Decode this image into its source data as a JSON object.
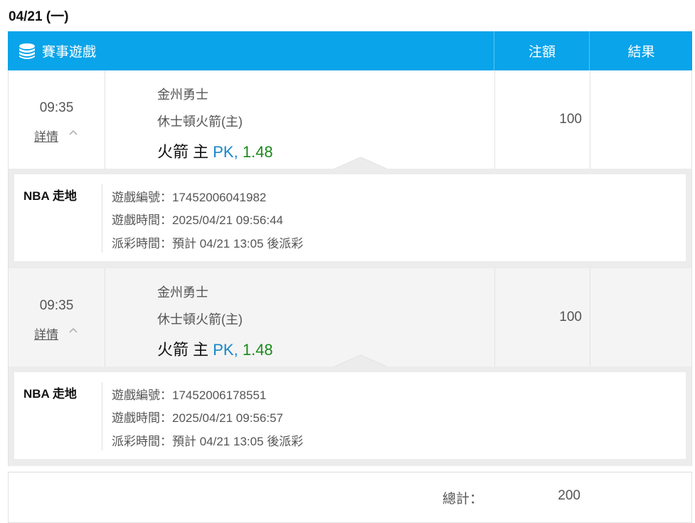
{
  "date": "04/21 (一)",
  "header": {
    "game_label": "賽事遊戲",
    "stake_label": "注額",
    "result_label": "結果"
  },
  "bets": [
    {
      "time": "09:35",
      "detail_link": "詳情",
      "team1": "金州勇士",
      "team2": "休士頓火箭(主)",
      "pick": "火箭 主",
      "pick_type": "PK,",
      "odds": "1.48",
      "stake": "100",
      "result": "",
      "game_type": "NBA 走地",
      "game_id": "遊戲編號：17452006041982",
      "game_time": "遊戲時間：2025/04/21 09:56:44",
      "payout_time": "派彩時間：預計 04/21 13:05 後派彩"
    },
    {
      "time": "09:35",
      "detail_link": "詳情",
      "team1": "金州勇士",
      "team2": "休士頓火箭(主)",
      "pick": "火箭 主",
      "pick_type": "PK,",
      "odds": "1.48",
      "stake": "100",
      "result": "",
      "game_type": "NBA 走地",
      "game_id": "遊戲編號：17452006178551",
      "game_time": "遊戲時間：2025/04/21 09:56:57",
      "payout_time": "派彩時間：預計 04/21 13:05 後派彩"
    }
  ],
  "total": {
    "label": "總計：",
    "value": "200"
  },
  "colors": {
    "header_bg": "#0aa4ea",
    "pk": "#1a86c8",
    "odds": "#1a8a1a"
  }
}
